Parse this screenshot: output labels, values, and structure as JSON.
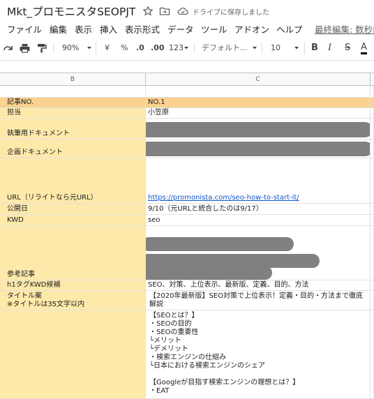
{
  "title": {
    "doc_name": "Mkt_プロモニスタSEOPJT",
    "save_status": "ドライブに保存しました"
  },
  "menu": {
    "items": [
      "ファイル",
      "編集",
      "表示",
      "挿入",
      "表示形式",
      "データ",
      "ツール",
      "アドオン",
      "ヘルプ"
    ],
    "last_edit": "最終編集: 数秒前"
  },
  "toolbar": {
    "zoom": "90%",
    "currency": "¥",
    "percent": "%",
    "dec_decrease": ".0",
    "dec_increase": ".00",
    "more_formats": "123",
    "font": "デフォルト...",
    "font_size": "10",
    "bold": "B",
    "italic": "I",
    "strike": "S",
    "text_color": "A"
  },
  "columns": {
    "b": "B",
    "c": "C"
  },
  "rows": [
    {
      "label": "",
      "value": ""
    },
    {
      "label": "記事NO.",
      "value": "NO.1"
    },
    {
      "label": "担当",
      "value": "小笠原"
    },
    {
      "label": "執筆用ドキュメント",
      "value": ""
    },
    {
      "label": "企画ドキュメント",
      "value": ""
    },
    {
      "label": "URL（リライトなら元URL）",
      "value": "https://promonista.com/seo-how-to-start-it/"
    },
    {
      "label": "公開日",
      "value": "9/10（元URLと統合したのは9/17）"
    },
    {
      "label": "KWD",
      "value": "seo"
    },
    {
      "label": "参考記事",
      "value": ""
    },
    {
      "label": "h1タグKWD候補",
      "value": "SEO、対策、上位表示、最新版、定義、目的、方法"
    },
    {
      "label": "タイトル案\n※タイトルは35文字以内",
      "value": "【2020年最新版】SEO対策で上位表示！定義・目的・方法まで徹底\n解説"
    },
    {
      "label": "",
      "value": "【SEOとは？】\n・SEOの目的\n・SEOの重要性\n└メリット\n└デメリット\n・検索エンジンの仕組み\n└日本における検索エンジンのシェア\n\n【Googleが目指す検索エンジンの理想とは？】\n・EAT"
    }
  ]
}
